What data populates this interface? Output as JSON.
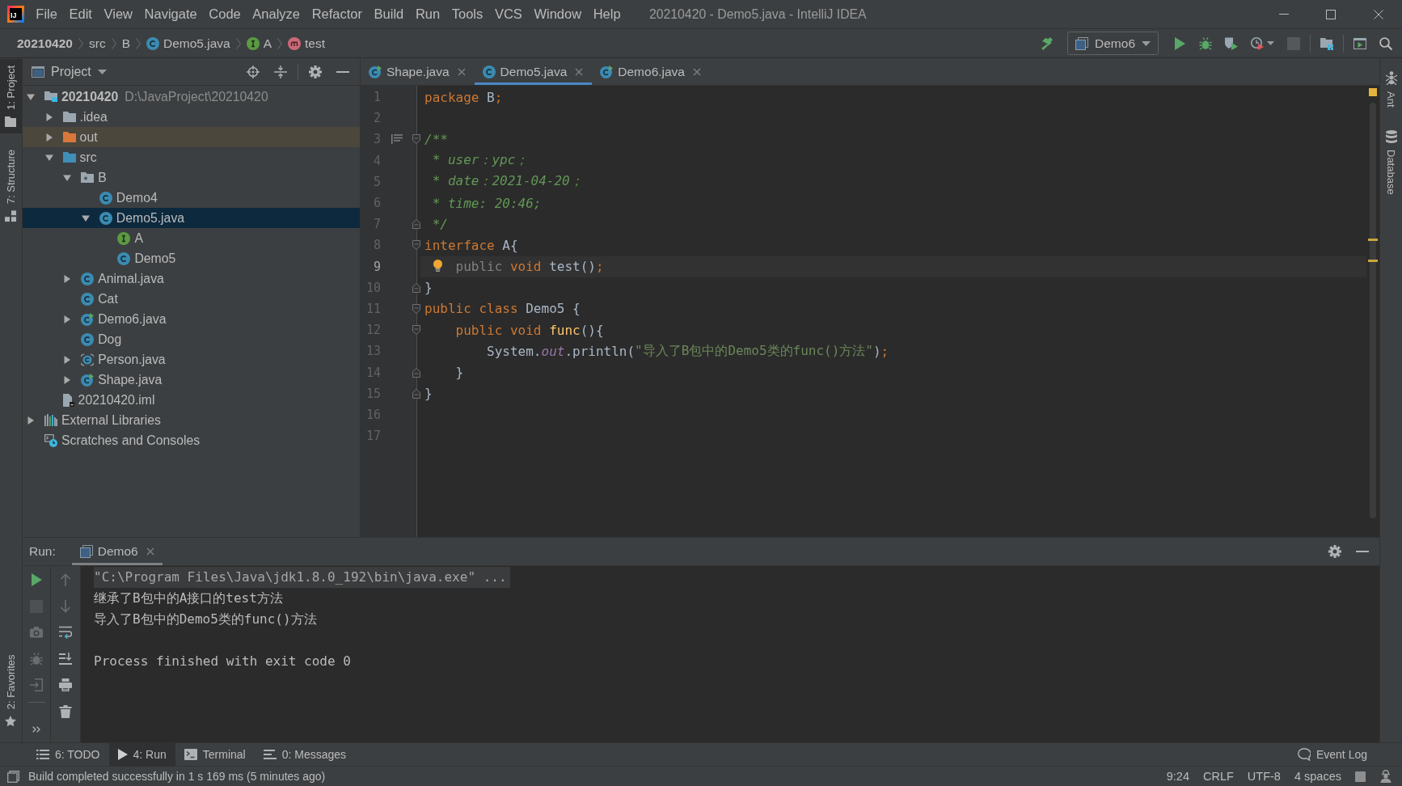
{
  "window": {
    "logo": "IJ",
    "title": "20210420 - Demo5.java - IntelliJ IDEA"
  },
  "menu": [
    "File",
    "Edit",
    "View",
    "Navigate",
    "Code",
    "Analyze",
    "Refactor",
    "Build",
    "Run",
    "Tools",
    "VCS",
    "Window",
    "Help"
  ],
  "navigation_bar": {
    "breadcrumbs": [
      {
        "label": "20210420",
        "kind": "project"
      },
      {
        "label": "src",
        "kind": "directory"
      },
      {
        "label": "B",
        "kind": "directory"
      },
      {
        "label": "Demo5.java",
        "kind": "class"
      },
      {
        "label": "A",
        "kind": "interface"
      },
      {
        "label": "test",
        "kind": "method"
      }
    ],
    "toolbar": [
      {
        "kind": "build",
        "disabled": false
      },
      {
        "kind": "run_config",
        "label": "Demo6",
        "disabled": false
      },
      {
        "kind": "run",
        "disabled": false
      },
      {
        "kind": "debug",
        "disabled": false
      },
      {
        "kind": "coverage",
        "disabled": false
      },
      {
        "kind": "profile",
        "disabled": false
      },
      {
        "kind": "stop",
        "disabled": true
      },
      {
        "kind": "separator"
      },
      {
        "kind": "project_structure",
        "disabled": false
      },
      {
        "kind": "separator"
      },
      {
        "kind": "presentation",
        "disabled": false
      },
      {
        "kind": "search",
        "disabled": false
      }
    ]
  },
  "left_strip": {
    "top": [
      {
        "label": "1: Project",
        "kind": "project",
        "selected": true
      },
      {
        "label": "7: Structure",
        "kind": "structure",
        "selected": false
      }
    ],
    "bottom": [
      {
        "label": "2: Favorites",
        "kind": "favorites",
        "selected": false
      }
    ]
  },
  "right_strip": [
    {
      "label": "Ant",
      "kind": "ant",
      "selected": false
    },
    {
      "label": "Database",
      "kind": "database",
      "selected": false
    }
  ],
  "project_panel": {
    "title": "Project",
    "tree": [
      {
        "label": "20210420",
        "path": "D:\\JavaProject\\20210420",
        "kind": "module",
        "expanded": true,
        "selected": false,
        "children": [
          {
            "label": ".idea",
            "kind": "folder",
            "expanded": false,
            "selected": false
          },
          {
            "label": "out",
            "kind": "excluded_folder",
            "expanded": false,
            "selected": false
          },
          {
            "label": "src",
            "kind": "source_folder",
            "expanded": true,
            "selected": false,
            "children": [
              {
                "label": "B",
                "kind": "package",
                "expanded": true,
                "selected": false,
                "children": [
                  {
                    "label": "Demo4",
                    "kind": "class",
                    "selected": false
                  },
                  {
                    "label": "Demo5.java",
                    "kind": "class",
                    "expanded": true,
                    "selected": true,
                    "children": [
                      {
                        "label": "A",
                        "kind": "interface",
                        "selected": false
                      },
                      {
                        "label": "Demo5",
                        "kind": "class",
                        "selected": false
                      }
                    ]
                  }
                ]
              },
              {
                "label": "Animal.java",
                "kind": "class",
                "expanded": false,
                "selected": false
              },
              {
                "label": "Cat",
                "kind": "class",
                "selected": false
              },
              {
                "label": "Demo6.java",
                "kind": "runnable_class",
                "expanded": false,
                "selected": false
              },
              {
                "label": "Dog",
                "kind": "class",
                "selected": false
              },
              {
                "label": "Person.java",
                "kind": "abstract_class",
                "expanded": false,
                "selected": false
              },
              {
                "label": "Shape.java",
                "kind": "runnable_class",
                "expanded": false,
                "selected": false
              }
            ]
          },
          {
            "label": "20210420.iml",
            "kind": "iml",
            "selected": false
          }
        ]
      },
      {
        "label": "External Libraries",
        "kind": "libraries",
        "expanded": false,
        "selected": false
      },
      {
        "label": "Scratches and Consoles",
        "kind": "scratches",
        "selected": false
      }
    ]
  },
  "editor": {
    "tabs": [
      {
        "label": "Shape.java",
        "kind": "runnable_class",
        "selected": false
      },
      {
        "label": "Demo5.java",
        "kind": "class",
        "selected": true
      },
      {
        "label": "Demo6.java",
        "kind": "runnable_class",
        "selected": false
      }
    ],
    "lines": [
      {
        "number": "1",
        "current": false,
        "tokens": [
          {
            "text": "package",
            "kind": "keyword"
          },
          {
            "text": " B",
            "kind": "plain"
          },
          {
            "text": ";",
            "kind": "keyword"
          }
        ]
      },
      {
        "number": "2",
        "current": false
      },
      {
        "number": "3",
        "current": false,
        "fold_start": true,
        "doc_toggle": true,
        "tokens": [
          {
            "text": "/**",
            "kind": "comment"
          }
        ]
      },
      {
        "number": "4",
        "current": false,
        "tokens": [
          {
            "text": " * user：ypc；",
            "kind": "comment"
          }
        ]
      },
      {
        "number": "5",
        "current": false,
        "tokens": [
          {
            "text": " * date：2021-04-20；",
            "kind": "comment"
          }
        ]
      },
      {
        "number": "6",
        "current": false,
        "tokens": [
          {
            "text": " * time: 20:46;",
            "kind": "comment"
          }
        ]
      },
      {
        "number": "7",
        "current": false,
        "fold_end": true,
        "tokens": [
          {
            "text": " */",
            "kind": "comment"
          }
        ]
      },
      {
        "number": "8",
        "current": false,
        "fold_start": true,
        "tokens": [
          {
            "text": "interface",
            "kind": "keyword"
          },
          {
            "text": " A{",
            "kind": "plain"
          }
        ]
      },
      {
        "number": "9",
        "current": true,
        "bulb": true,
        "tokens": [
          {
            "text": "    public",
            "kind": "redundant"
          },
          {
            "text": " void",
            "kind": "keyword"
          },
          {
            "text": " test()",
            "kind": "plain"
          },
          {
            "text": ";",
            "kind": "keyword"
          }
        ]
      },
      {
        "number": "10",
        "current": false,
        "fold_end": true,
        "tokens": [
          {
            "text": "}",
            "kind": "plain"
          }
        ]
      },
      {
        "number": "11",
        "current": false,
        "fold_start": true,
        "tokens": [
          {
            "text": "public class",
            "kind": "keyword"
          },
          {
            "text": " Demo5 {",
            "kind": "plain"
          }
        ]
      },
      {
        "number": "12",
        "current": false,
        "fold_start": true,
        "tokens": [
          {
            "text": "    public void",
            "kind": "keyword"
          },
          {
            "text": " func",
            "kind": "method"
          },
          {
            "text": "(){",
            "kind": "plain"
          }
        ]
      },
      {
        "number": "13",
        "current": false,
        "tokens": [
          {
            "text": "        System.",
            "kind": "plain"
          },
          {
            "text": "out",
            "kind": "field"
          },
          {
            "text": ".println(",
            "kind": "plain"
          },
          {
            "text": "\"导入了B包中的Demo5类的func()方法\"",
            "kind": "string"
          },
          {
            "text": ")",
            "kind": "plain"
          },
          {
            "text": ";",
            "kind": "keyword"
          }
        ]
      },
      {
        "number": "14",
        "current": false,
        "fold_end": true,
        "tokens": [
          {
            "text": "    }",
            "kind": "plain"
          }
        ]
      },
      {
        "number": "15",
        "current": false,
        "fold_end": true,
        "tokens": [
          {
            "text": "}",
            "kind": "plain"
          }
        ]
      },
      {
        "number": "16",
        "current": false
      },
      {
        "number": "17",
        "current": false
      }
    ]
  },
  "run_panel": {
    "label": "Run:",
    "tabs": [
      {
        "label": "Demo6",
        "selected": true
      }
    ],
    "left_actions": [
      {
        "kind": "rerun",
        "disabled": false
      },
      {
        "kind": "stop",
        "disabled": true
      },
      {
        "kind": "camera",
        "disabled": true
      },
      {
        "kind": "debug_settings",
        "disabled": true
      },
      {
        "kind": "exit",
        "disabled": true
      }
    ],
    "right_actions": [
      {
        "kind": "up",
        "disabled": true
      },
      {
        "kind": "down",
        "disabled": true
      },
      {
        "kind": "soft_wrap",
        "disabled": false
      },
      {
        "kind": "scroll_end",
        "disabled": false
      },
      {
        "kind": "print",
        "disabled": false
      },
      {
        "kind": "clear",
        "disabled": false
      }
    ],
    "console": [
      {
        "kind": "command",
        "text": "\"C:\\Program Files\\Java\\jdk1.8.0_192\\bin\\java.exe\" ..."
      },
      {
        "kind": "output",
        "text": "继承了B包中的A接口的test方法"
      },
      {
        "kind": "output",
        "text": "导入了B包中的Demo5类的func()方法"
      },
      {
        "kind": "system",
        "text": "Process finished with exit code 0"
      }
    ]
  },
  "tool_windows": {
    "items": [
      {
        "label": "6: TODO",
        "kind": "todo",
        "selected": false
      },
      {
        "label": "4: Run",
        "kind": "run",
        "selected": true
      },
      {
        "label": "Terminal",
        "kind": "terminal",
        "selected": false
      },
      {
        "label": "0: Messages",
        "kind": "messages",
        "selected": false
      }
    ],
    "event_log": "Event Log"
  },
  "status_bar": {
    "message": "Build completed successfully in 1 s 169 ms (5 minutes ago)",
    "items": [
      "9:24",
      "CRLF",
      "UTF-8",
      "4 spaces"
    ]
  }
}
